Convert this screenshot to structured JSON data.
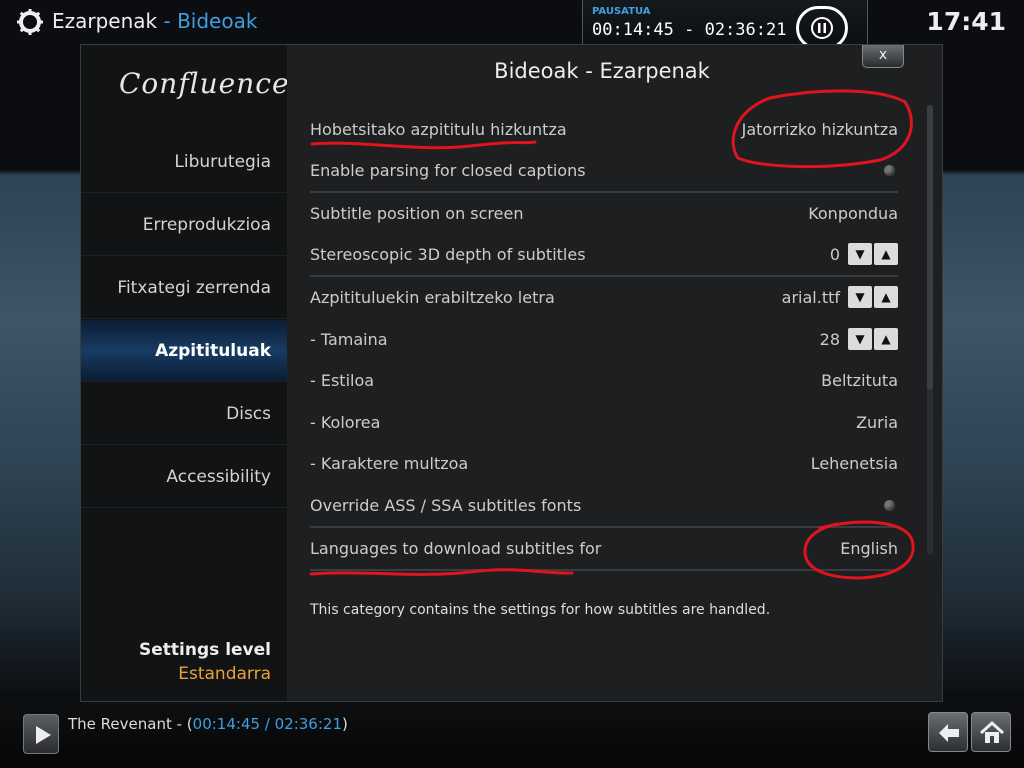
{
  "header": {
    "section": "Ezarpenak",
    "separator": " - ",
    "subsection": "Bideoak",
    "clock": "17:41"
  },
  "now_playing": {
    "status": "PAUSATUA",
    "time": "00:14:45 - 02:36:21",
    "progress": 0.09
  },
  "window": {
    "title": "Bideoak - Ezarpenak",
    "close_label": "x"
  },
  "sidebar": {
    "logo": "Confluence",
    "items": [
      {
        "label": "Liburutegia"
      },
      {
        "label": "Erreprodukzioa"
      },
      {
        "label": "Fitxategi zerrenda"
      },
      {
        "label": "Azpitituluak"
      },
      {
        "label": "Discs"
      },
      {
        "label": "Accessibility"
      }
    ],
    "active_index": 3,
    "settings_level_label": "Settings level",
    "settings_level_value": "Estandarra"
  },
  "settings": [
    {
      "label": "Hobetsitako azpititulu hizkuntza",
      "value": "Jatorrizko hizkuntza",
      "control": "text"
    },
    {
      "label": "Enable parsing for closed captions",
      "value": "",
      "control": "radio"
    },
    {
      "label": "Subtitle position on screen",
      "value": "Konpondua",
      "control": "text"
    },
    {
      "label": "Stereoscopic 3D depth of subtitles",
      "value": "0",
      "control": "spin"
    },
    {
      "label": "Azpitituluekin erabiltzeko letra",
      "value": "arial.ttf",
      "control": "spin"
    },
    {
      "label": "- Tamaina",
      "value": "28",
      "control": "spin"
    },
    {
      "label": "- Estiloa",
      "value": "Beltzituta",
      "control": "text"
    },
    {
      "label": "- Kolorea",
      "value": "Zuria",
      "control": "text"
    },
    {
      "label": "- Karaktere multzoa",
      "value": "Lehenetsia",
      "control": "text"
    },
    {
      "label": "Override ASS / SSA subtitles fonts",
      "value": "",
      "control": "radio"
    },
    {
      "label": "Languages to download subtitles for",
      "value": "English",
      "control": "text"
    }
  ],
  "description": "This category contains the settings for how subtitles are handled.",
  "bottom": {
    "title": "The Revenant - ",
    "time_open": "(",
    "time": "00:14:45 / 02:36:21",
    "time_close": ")"
  },
  "icons": {
    "gear": "gear-icon",
    "pause": "pause-icon",
    "play": "play-icon",
    "back": "back-arrow-icon",
    "home": "home-icon"
  },
  "colors": {
    "accent_blue": "#3f9fe0",
    "settings_level_orange": "#e8a23a",
    "annotation_red": "#e0141e"
  }
}
